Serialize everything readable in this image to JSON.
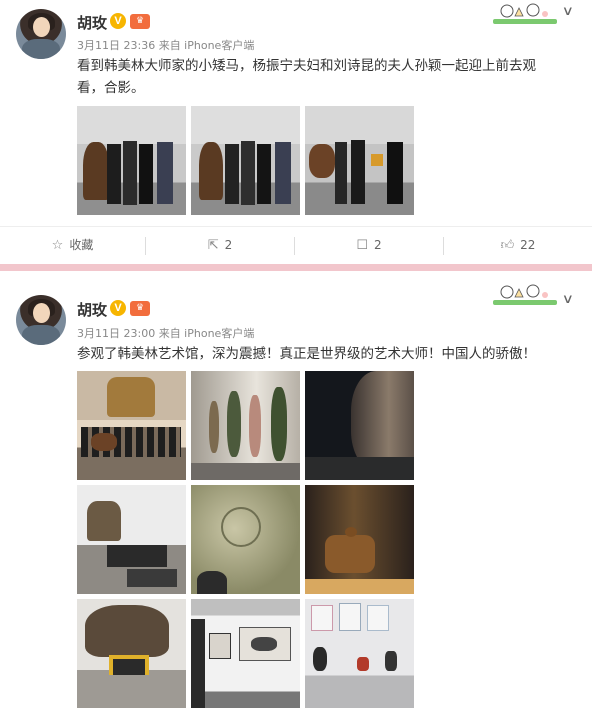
{
  "posts": [
    {
      "author": "胡玫",
      "verified": "V",
      "meta": "3月11日 23:36 来自 iPhone客户端",
      "text_line1": "看到韩美林大师家的小矮马，杨振宁夫妇和刘诗昆的夫人孙颖一起迎上前去观",
      "text_line2": "看，合影。",
      "actions": {
        "favorite": "收藏",
        "repost": "2",
        "comment": "2",
        "like": "22"
      }
    },
    {
      "author": "胡玫",
      "verified": "V",
      "meta": "3月11日 23:00 来自 iPhone客户端",
      "text": "参观了韩美林艺术馆，深为震撼！真正是世界级的艺术大师！中国人的骄傲！"
    }
  ],
  "icons": {
    "avatar": "avatar",
    "verified": "verified-badge-icon",
    "member": "crown-icon",
    "menu": "chevron-down-icon",
    "favorite": "star-icon",
    "repost": "repost-icon",
    "comment": "comment-icon",
    "like": "thumbs-up-icon"
  },
  "colors": {
    "verified": "#f7b500",
    "divider": "#f2c6cc",
    "meta": "#888888"
  }
}
